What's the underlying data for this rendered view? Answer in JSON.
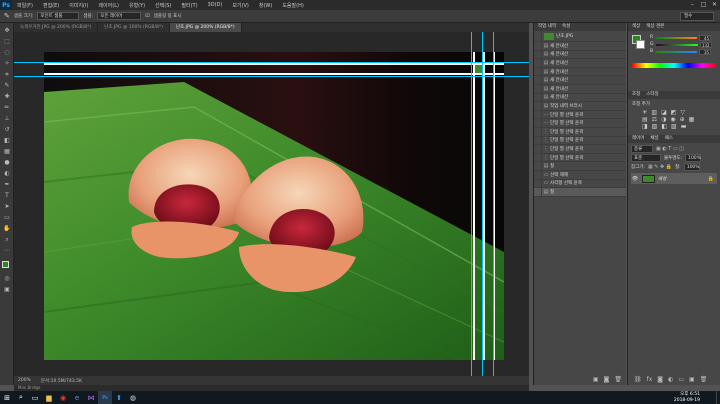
{
  "menubar": {
    "logo": "Ps",
    "items": [
      "파일(F)",
      "편집(E)",
      "이미지(I)",
      "레이어(L)",
      "유형(Y)",
      "선택(S)",
      "필터(T)",
      "3D(D)",
      "보기(V)",
      "창(W)",
      "도움말(H)"
    ]
  },
  "options": {
    "label1": "샘플 크기:",
    "sample_size": "포인트 샘플",
    "label2": "샘플:",
    "sample": "모든 레이어",
    "ring_label": "샘플링 링 표시",
    "workspace": "필수"
  },
  "tabs": [
    "녹색우거진.JPG @ 200% (RGB/8*)",
    "난초.JPG @ 100% (RGB/8*)",
    "난초.JPG @ 200% (RGB/8*)"
  ],
  "status": {
    "zoom": "200%",
    "doc": "문서:10.5M/743.5K"
  },
  "bottom_tab": "Mini Bridge",
  "history": {
    "tabs": [
      "작업 내역",
      "속성"
    ],
    "snapshot": "난초.JPG",
    "rows": [
      {
        "icon": "▤",
        "label": "새 안내선"
      },
      {
        "icon": "▤",
        "label": "새 안내선"
      },
      {
        "icon": "▤",
        "label": "새 안내선"
      },
      {
        "icon": "▤",
        "label": "새 안내선"
      },
      {
        "icon": "▤",
        "label": "새 안내선"
      },
      {
        "icon": "▤",
        "label": "새 안내선"
      },
      {
        "icon": "▤",
        "label": "새 안내선"
      },
      {
        "icon": "▤",
        "label": "작업 내역 브러시"
      },
      {
        "icon": "⋯",
        "label": "단일 열 선택 윤곽"
      },
      {
        "icon": "⋯",
        "label": "단일 열 선택 윤곽"
      },
      {
        "icon": "⋮",
        "label": "단일 열 선택 윤곽"
      },
      {
        "icon": "⋮",
        "label": "단일 열 선택 윤곽"
      },
      {
        "icon": "⋮",
        "label": "단일 열 선택 윤곽"
      },
      {
        "icon": "⋮",
        "label": "단일 열 선택 윤곽"
      },
      {
        "icon": "▤",
        "label": "칠"
      },
      {
        "icon": "▭",
        "label": "선택 해제"
      },
      {
        "icon": "▭",
        "label": "사각형 선택 윤곽"
      },
      {
        "icon": "▤",
        "label": "칠"
      }
    ]
  },
  "color_panel": {
    "tabs": [
      "색상",
      "색상 견본"
    ],
    "r_label": "R",
    "g_label": "G",
    "b_label": "B",
    "r": "45",
    "g": "132",
    "b": "35"
  },
  "adjust_panel": {
    "tabs": [
      "조정",
      "스타일"
    ],
    "title": "조정 추가"
  },
  "layers_panel": {
    "tabs": [
      "레이어",
      "채널",
      "패스"
    ],
    "kind_label": "종류",
    "blend_mode": "표준",
    "opacity_label": "불투명도:",
    "opacity": "100%",
    "lock_label": "잠그기:",
    "fill_label": "칠:",
    "fill": "100%",
    "layer_name": "배경"
  },
  "taskbar": {
    "time": "오후 6:51",
    "date": "2018-09-19"
  },
  "colors": {
    "guide": "#00c8ff",
    "leaf_green": "#3f8a2a",
    "petal": "#e9a37a",
    "accent_blue": "#0078d7"
  }
}
